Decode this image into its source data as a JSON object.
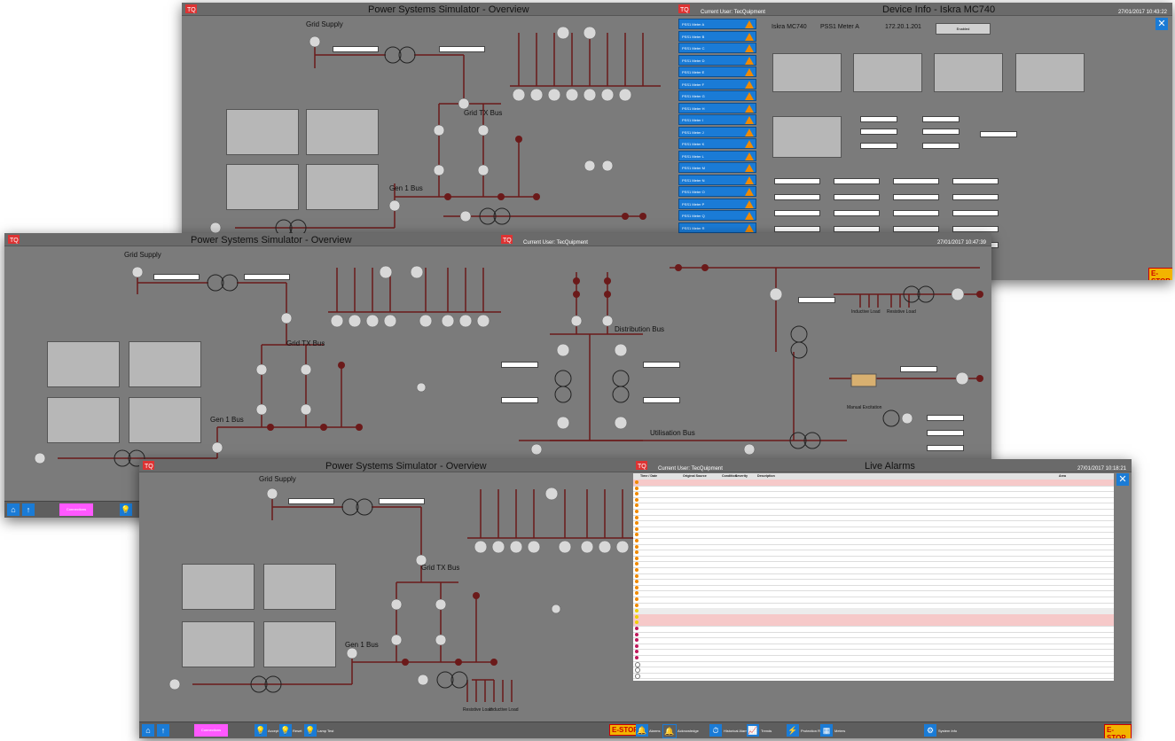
{
  "brand": {
    "logo_text": "TQ"
  },
  "window_top": {
    "left_title": "Power Systems Simulator - Overview",
    "current_user": "Current User: TecQuipment",
    "right_title": "Device Info - Iskra MC740",
    "timestamp": "27/01/2017 10:43:22",
    "labels": {
      "grid_supply": "Grid Supply",
      "grid_tx_bus": "Grid TX Bus",
      "gen1_bus": "Gen 1 Bus"
    },
    "device": {
      "model": "Iskra MC740",
      "meter": "PSS1 Meter A",
      "ip": "172.20.1.201",
      "enabled_label": "Enabled"
    },
    "meter_list": [
      "PSS1 Meter A",
      "PSS1 Meter B",
      "PSS1 Meter C",
      "PSS1 Meter D",
      "PSS1 Meter E",
      "PSS1 Meter F",
      "PSS1 Meter G",
      "PSS1 Meter H",
      "PSS1 Meter I",
      "PSS1 Meter J",
      "PSS1 Meter K",
      "PSS1 Meter L",
      "PSS1 Meter M",
      "PSS1 Meter N",
      "PSS1 Meter O",
      "PSS1 Meter P",
      "PSS1 Meter Q",
      "PSS1 Meter R"
    ],
    "estop": "E-STOP"
  },
  "window_mid": {
    "left_title": "Power Systems Simulator - Overview",
    "current_user": "Current User: TecQuipment",
    "timestamp": "27/01/2017 10:47:39",
    "labels": {
      "grid_supply": "Grid Supply",
      "grid_tx_bus": "Grid TX Bus",
      "gen1_bus": "Gen 1 Bus",
      "distribution_bus": "Distribution Bus",
      "utilisation_bus": "Utilisation Bus",
      "manual_excitation": "Manual Excitation",
      "inductive_load": "Inductive Load",
      "resistive_load": "Resistive Load"
    },
    "pink_button": "Connections"
  },
  "window_bot": {
    "left_title": "Power Systems Simulator - Overview",
    "current_user": "Current User: TecQuipment",
    "right_title": "Live Alarms",
    "timestamp": "27/01/2017 10:18:21",
    "labels": {
      "grid_supply": "Grid Supply",
      "grid_tx_bus": "Grid TX Bus",
      "gen1_bus": "Gen 1 Bus",
      "resistive_load": "Resistive Load",
      "inductive_load": "Inductive Load"
    },
    "pink_button": "Connections",
    "bottom_buttons": [
      "Accept",
      "Reset",
      "Lamp Test",
      "Alarms",
      "Acknowledge",
      "Historical Alarms",
      "Trends",
      "Protection Relays",
      "Meters",
      "System Info"
    ],
    "estop_left": "E-STOP",
    "estop_right": "E-STOP",
    "alarm_headers": [
      "Time / Date",
      "Original Source",
      "Condition",
      "Severity",
      "Description",
      "Area"
    ]
  },
  "colors": {
    "bg": "#7b7b7b",
    "accent_blue": "#1a7bd6",
    "warn": "#f08a00",
    "line": "#6b1a1a",
    "pink": "#ff58ff",
    "estop": "#f2b400"
  }
}
